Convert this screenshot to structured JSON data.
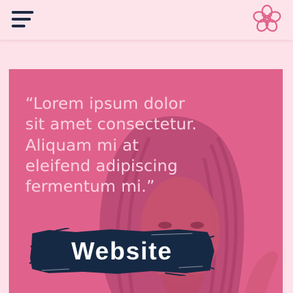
{
  "header": {
    "menu_icon": "hamburger-menu-icon",
    "logo_icon": "flower-logo-icon"
  },
  "hero": {
    "quote": "“Lorem ipsum dolor sit amet consectetur. Aliquam mi at eleifend adipiscing fermentum mi.”",
    "cta_label": "Website"
  },
  "colors": {
    "background": "#fde2e9",
    "header": "#fde4ea",
    "hero_overlay": "#e0628c",
    "quote_text": "#fbd3df",
    "cta_background": "#162944",
    "cta_text": "#ffffff",
    "icon_dark": "#1f2a44",
    "logo": "#e0628c"
  }
}
